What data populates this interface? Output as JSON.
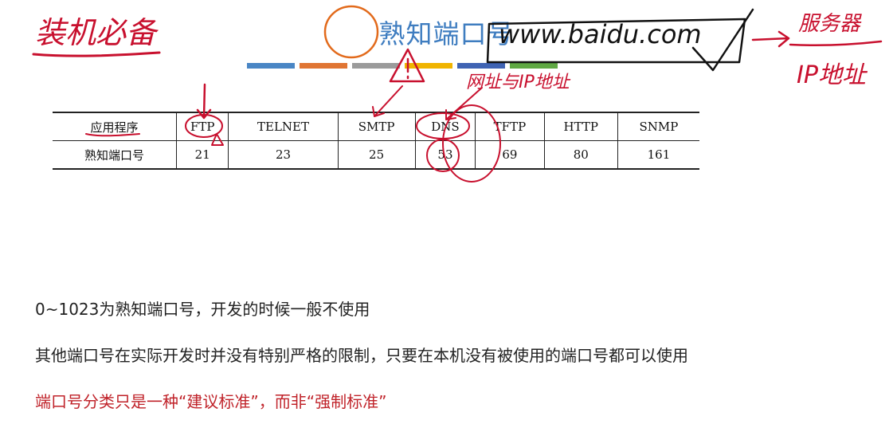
{
  "title": "熟知端口号",
  "color_bars": [
    "#4a86c5",
    "#e07533",
    "#9b9b9b",
    "#f0b400",
    "#3f63b3",
    "#5fa843"
  ],
  "table": {
    "header_label": "应用程序",
    "row_label": "熟知端口号",
    "columns": [
      {
        "app": "FTP",
        "port": "21"
      },
      {
        "app": "TELNET",
        "port": "23"
      },
      {
        "app": "SMTP",
        "port": "25"
      },
      {
        "app": "DNS",
        "port": "53"
      },
      {
        "app": "TFTP",
        "port": "69"
      },
      {
        "app": "HTTP",
        "port": "80"
      },
      {
        "app": "SNMP",
        "port": "161"
      }
    ]
  },
  "paragraphs": {
    "line1": "0~1023为熟知端口号，开发的时候一般不使用",
    "line2": "其他端口号在实际开发时并没有特别严格的限制，只要在本机没有被使用的端口号都可以使用",
    "line3": "端口号分类只是一种“建议标准”，而非“强制标准”"
  },
  "annotations": {
    "top_left": "装机必备",
    "url": "www.baidu.com",
    "top_right": "服务器",
    "ip": "IP地址",
    "mid": "网址与IP地址",
    "ink_color": "#c8102e"
  }
}
